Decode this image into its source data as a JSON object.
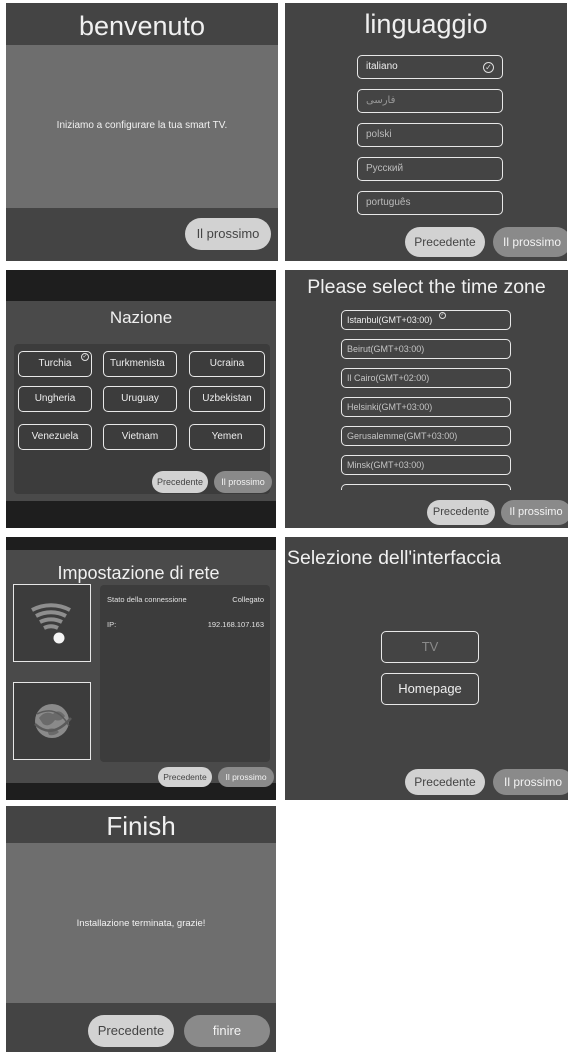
{
  "welcome": {
    "title": "benvenuto",
    "message": "Iniziamo a configurare la tua smart TV.",
    "next": "Il prossimo"
  },
  "language": {
    "title": "linguaggio",
    "options": [
      "italiano",
      "فارسی",
      "polski",
      "Русский",
      "português"
    ],
    "selected": "italiano",
    "prev": "Precedente",
    "next": "Il prossimo"
  },
  "country": {
    "title": "Nazione",
    "options": [
      "Turchia",
      "Turkmenista",
      "Ucraina",
      "Ungheria",
      "Uruguay",
      "Uzbekistan",
      "Venezuela",
      "Vietnam",
      "Yemen"
    ],
    "selected": "Turchia",
    "prev": "Precedente",
    "next": "Il prossimo"
  },
  "timezone": {
    "title": "Please select the time zone",
    "options": [
      "Istanbul(GMT+03:00)",
      "Beirut(GMT+03:00)",
      "Il Cairo(GMT+02:00)",
      "Helsinki(GMT+03:00)",
      "Gerusalemme(GMT+03:00)",
      "Minsk(GMT+03:00)"
    ],
    "selected": "Istanbul(GMT+03:00)",
    "prev": "Precedente",
    "next": "Il prossimo"
  },
  "network": {
    "title": "Impostazione di rete",
    "status_label": "Stato della connessione",
    "status_value": "Collegato",
    "ip_label": "IP:",
    "ip_value": "192.168.107.163",
    "prev": "Precedente",
    "next": "Il prossimo",
    "icons": [
      "wifi-icon",
      "globe-icon"
    ]
  },
  "interface": {
    "title": "Selezione dell'interfaccia",
    "options": [
      "TV",
      "Homepage"
    ],
    "prev": "Precedente",
    "next": "Il prossimo"
  },
  "finish": {
    "title": "Finish",
    "message": "Installazione terminata, grazie!",
    "prev": "Precedente",
    "finish": "finire"
  }
}
